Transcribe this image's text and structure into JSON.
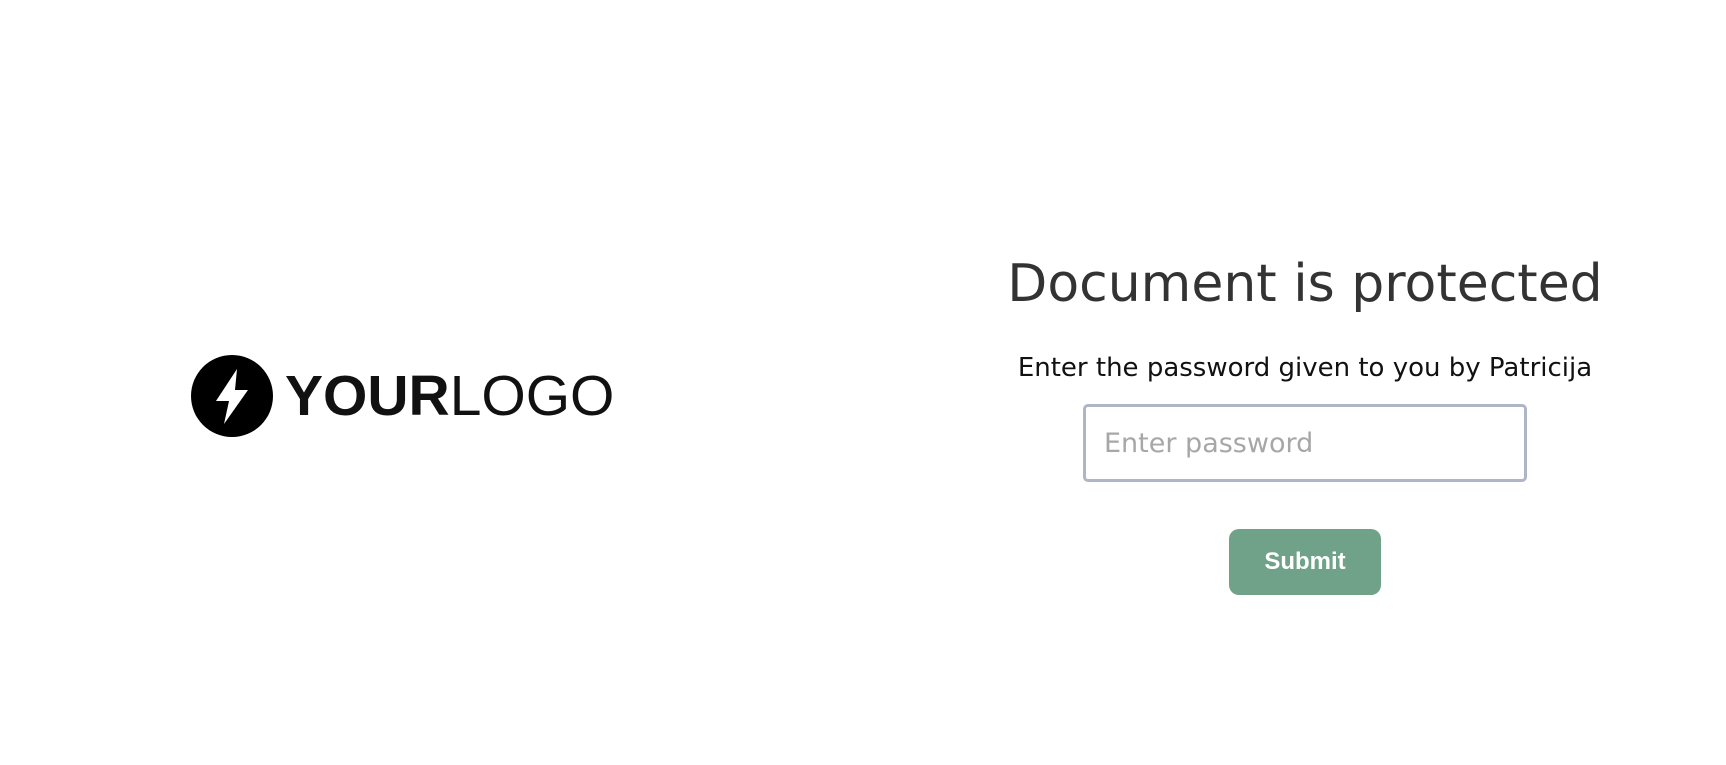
{
  "logo": {
    "icon": "lightning-bolt-icon",
    "text_bold": "YOUR",
    "text_light": "LOGO"
  },
  "auth": {
    "title": "Document is protected",
    "prompt": "Enter the password given to you by Patricija",
    "password_placeholder": "Enter password",
    "password_value": "",
    "submit_label": "Submit"
  },
  "colors": {
    "background": "#ffffff",
    "button": "#70a289",
    "input_border": "#aeb5c7",
    "title": "#333333"
  }
}
